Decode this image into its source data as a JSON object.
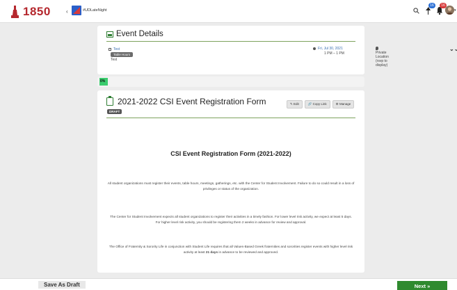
{
  "header": {
    "logo_text": "1850",
    "back_label": "‹",
    "org_name": "#UDLateNight",
    "pin_badge": "16",
    "bell_badge": "16",
    "colors": {
      "brand": "#b5282e",
      "accent_green": "#2e7d32"
    }
  },
  "event": {
    "title": "Event Details",
    "name": "Test",
    "tag": "Table Hours",
    "description": "Test",
    "date": "Fri, Jul 30, 2021",
    "time": "1 PM – 1 PM",
    "location": "Private Location (rsvp to display)",
    "expand_icon": "double-chevron-down-icon"
  },
  "progress": {
    "label": "0%",
    "value": 0
  },
  "form": {
    "title": "2021-2022 CSI Event Registration Form",
    "status": "DRAFT",
    "edit_label": "✎ Edit",
    "copy_link_label": "🔗 Copy Link",
    "manage_label": "⚙ Manage",
    "heading": "CSI Event Registration Form (2021-2022)",
    "paragraphs": [
      "All student organizations must register their events, table hours, meetings, gatherings, etc. with the Center for Student Involvement. Failure to do so could result in a loss of privileges or status of the organization.",
      "The Center for Student Involvement expects all student organizations to register their activities in a timely fashion. For lower level risk activity, we expect at least 5 days. For higher level risk activity, you should be registering them 2 weeks in advance for review and approval.",
      "The Office of Fraternity & Sorority Life in conjunction with Student Life requires that all Values-Based Greek fraternities and sororities register events with higher level risk activity at least 21 days in advance to be reviewed and approved."
    ]
  },
  "footer": {
    "save_draft_label": "Save As Draft",
    "next_label": "Next »"
  }
}
